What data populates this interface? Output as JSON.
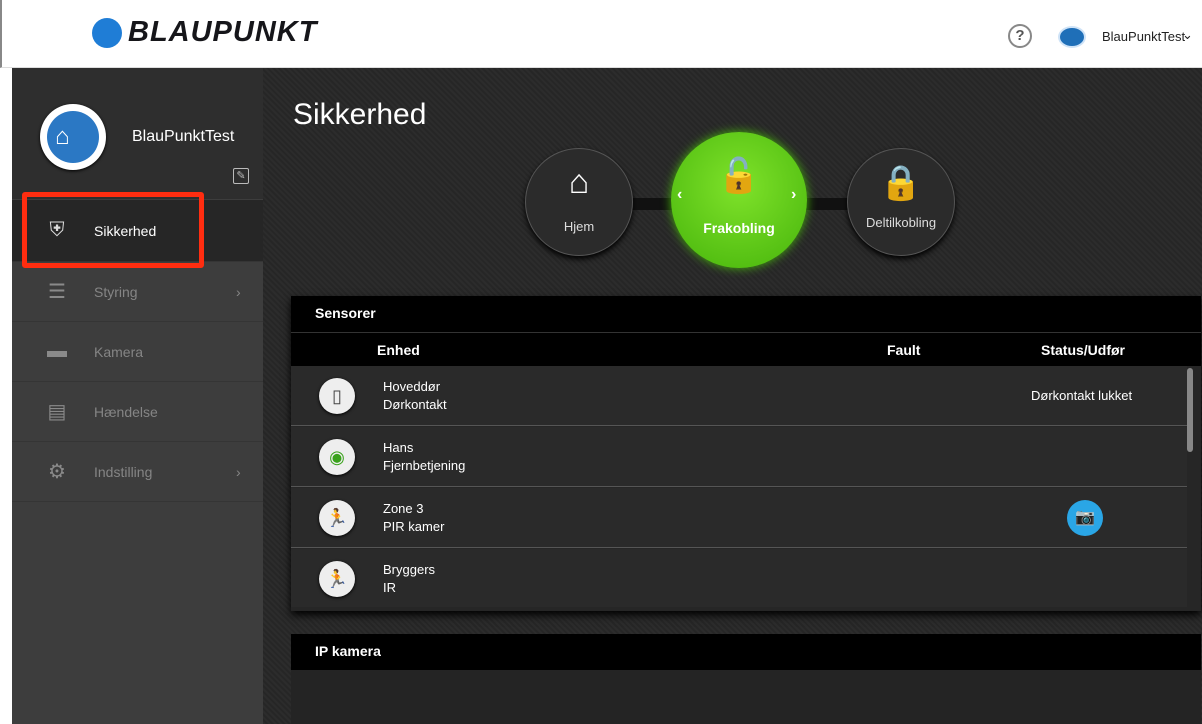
{
  "header": {
    "logo_text": "BLAUPUNKT",
    "help_icon": "?",
    "user_name": "BlauPunktTest",
    "chevron": "⌄"
  },
  "sidebar": {
    "profile_name": "BlauPunktTest",
    "items": [
      {
        "label": "Sikkerhed",
        "icon": "shield-icon",
        "glyph": "⛨",
        "active": true
      },
      {
        "label": "Styring",
        "icon": "sliders-icon",
        "glyph": "☰",
        "chevron": "›"
      },
      {
        "label": "Kamera",
        "icon": "camera-icon",
        "glyph": "▬"
      },
      {
        "label": "Hændelse",
        "icon": "list-icon",
        "glyph": "▤"
      },
      {
        "label": "Indstilling",
        "icon": "gear-icon",
        "glyph": "⚙",
        "chevron": "›"
      }
    ]
  },
  "main": {
    "title": "Sikkerhed",
    "modes": {
      "hjem": {
        "label": "Hjem",
        "glyph": "⌂"
      },
      "frakobling": {
        "label": "Frakobling",
        "glyph": "🔓",
        "active": true,
        "left_arrow": "‹",
        "right_arrow": "›"
      },
      "deltilkobling": {
        "label": "Deltilkobling",
        "glyph": "🔒"
      }
    },
    "sensors": {
      "header": "Sensorer",
      "columns": {
        "device": "Enhed",
        "fault": "Fault",
        "status": "Status/Udfør"
      },
      "rows": [
        {
          "name": "Hoveddør",
          "type": "Dørkontakt",
          "icon": "door-contact-icon",
          "glyph": "▯",
          "status": "Dørkontakt lukket"
        },
        {
          "name": "Hans",
          "type": "Fjernbetjening",
          "icon": "remote-control-icon",
          "glyph": "◉",
          "status": ""
        },
        {
          "name": "Zone 3",
          "type": "PIR kamer",
          "icon": "pir-camera-icon",
          "glyph": "🏃",
          "status": "",
          "camera_button": true,
          "camera_glyph": "📷"
        },
        {
          "name": "Bryggers",
          "type": "IR",
          "icon": "ir-sensor-icon",
          "glyph": "🏃",
          "status": ""
        }
      ]
    },
    "ip_camera": {
      "header": "IP kamera"
    }
  },
  "colors": {
    "accent_green": "#46b40b",
    "brand_blue": "#1f7dd6",
    "highlight_red": "#ff2d10",
    "camera_blue": "#2aa6e6"
  }
}
